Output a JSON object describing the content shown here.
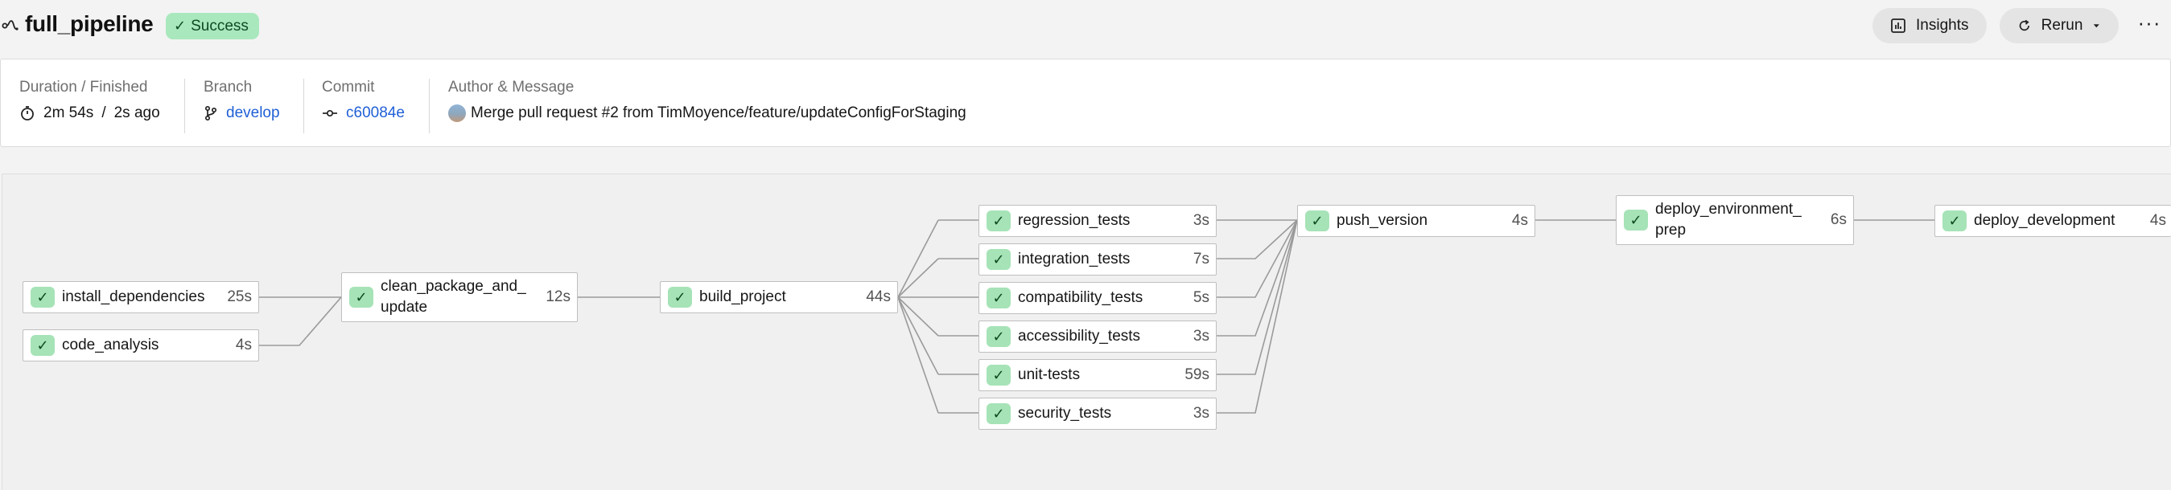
{
  "header": {
    "title": "full_pipeline",
    "status": "Success",
    "insights_label": "Insights",
    "rerun_label": "Rerun",
    "more_label": "···"
  },
  "info": {
    "duration_label": "Duration / Finished",
    "duration": "2m 54s",
    "divider": "/",
    "finished": "2s ago",
    "branch_label": "Branch",
    "branch": "develop",
    "commit_label": "Commit",
    "commit": "c60084e",
    "author_label": "Author & Message",
    "message": "Merge pull request #2 from TimMoyence/feature/updateConfigForStaging"
  },
  "jobs": {
    "install_dependencies": {
      "name": "install_dependencies",
      "duration": "25s"
    },
    "code_analysis": {
      "name": "code_analysis",
      "duration": "4s"
    },
    "clean_package_and_update": {
      "name_line1": "clean_package_and_",
      "name_line2": "update",
      "duration": "12s"
    },
    "build_project": {
      "name": "build_project",
      "duration": "44s"
    },
    "regression_tests": {
      "name": "regression_tests",
      "duration": "3s"
    },
    "integration_tests": {
      "name": "integration_tests",
      "duration": "7s"
    },
    "compatibility_tests": {
      "name": "compatibility_tests",
      "duration": "5s"
    },
    "accessibility_tests": {
      "name": "accessibility_tests",
      "duration": "3s"
    },
    "unit_tests": {
      "name": "unit-tests",
      "duration": "59s"
    },
    "security_tests": {
      "name": "security_tests",
      "duration": "3s"
    },
    "push_version": {
      "name": "push_version",
      "duration": "4s"
    },
    "deploy_environment_prep": {
      "name_line1": "deploy_environment_",
      "name_line2": "prep",
      "duration": "6s"
    },
    "deploy_development": {
      "name": "deploy_development",
      "duration": "4s"
    }
  },
  "icons": {
    "status": "check-icon",
    "pipeline": "pipeline-icon",
    "insights": "bar-chart-icon",
    "rerun": "refresh-icon",
    "duration": "timer-icon",
    "branch": "git-branch-icon",
    "commit": "git-commit-icon"
  },
  "colors": {
    "success_badge": "#a9e8bd",
    "success_text": "#0f4a23",
    "link": "#1f5fd6"
  }
}
